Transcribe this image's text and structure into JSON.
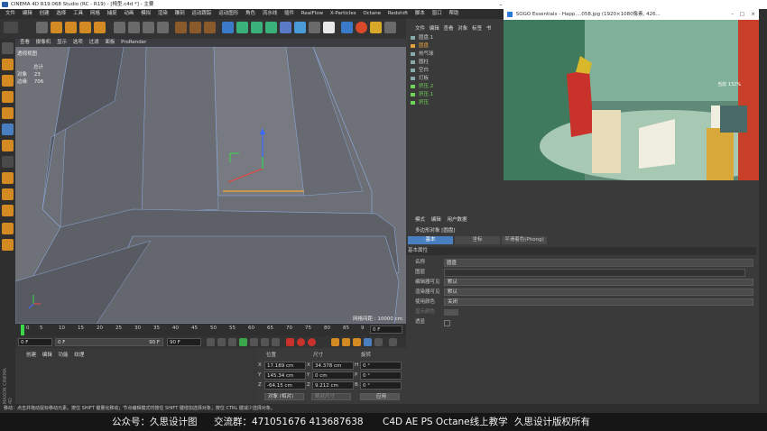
{
  "window": {
    "title": "CINEMA 4D R19.068 Studio (RC - R19) - [椅型.c4d *] - 主要"
  },
  "menu": [
    "文件",
    "编辑",
    "创建",
    "选择",
    "工具",
    "网格",
    "捕捉",
    "动画",
    "模拟",
    "渲染",
    "雕刻",
    "运动跟踪",
    "运动图形",
    "角色",
    "流水线",
    "插件",
    "RealFlow",
    "X-Particles",
    "Octane",
    "Redshift",
    "脚本",
    "窗口",
    "帮助"
  ],
  "viewport": {
    "menu": [
      "查看",
      "摄像机",
      "显示",
      "选项",
      "过滤",
      "面板",
      "ProRender"
    ],
    "camera_label": "透视视图",
    "stats": {
      "header": "总计",
      "rows": [
        {
          "label": "对象",
          "value": "23"
        },
        {
          "label": "边缘",
          "value": "706"
        }
      ]
    },
    "grid_label": "网格间距 : 10000 cm"
  },
  "timeline": {
    "ticks": [
      "0",
      "5",
      "10",
      "15",
      "20",
      "25",
      "30",
      "35",
      "40",
      "45",
      "50",
      "55",
      "60",
      "65",
      "70",
      "75",
      "80",
      "85",
      "9"
    ],
    "end_field": "0 F"
  },
  "transport": {
    "current_frame": "0 F",
    "range_start": "0 F",
    "range_end": "90 F",
    "end_frame": "90 F"
  },
  "material_manager": {
    "menu": [
      "创建",
      "编辑",
      "功能",
      "纹理"
    ]
  },
  "coordinates": {
    "headers": {
      "position": "位置",
      "size": "尺寸",
      "rotation": "旋转"
    },
    "rows": [
      {
        "axis": "X",
        "pos": "17.189 cm",
        "size_axis": "X",
        "size": "34.378 cm",
        "rot_axis": "H",
        "rot": "0 °"
      },
      {
        "axis": "Y",
        "pos": "145.34 cm",
        "size_axis": "Y",
        "size": "0 cm",
        "rot_axis": "P",
        "rot": "0 °"
      },
      {
        "axis": "Z",
        "pos": "-64.15 cm",
        "size_axis": "Z",
        "size": "9.212 cm",
        "rot_axis": "B",
        "rot": "0 °"
      }
    ],
    "mode": "对象 (相对)",
    "size_mode": "绝对尺寸",
    "apply": "应用"
  },
  "object_manager": {
    "menu": [
      "文件",
      "编辑",
      "查看",
      "对象",
      "标签",
      "书"
    ],
    "objects": [
      {
        "name": "圆盘.1",
        "color": "#c8c8c8"
      },
      {
        "name": "圆盘",
        "color": "#e6a23a"
      },
      {
        "name": "热气球",
        "color": "#c8c8c8"
      },
      {
        "name": "圆柱",
        "color": "#c8c8c8"
      },
      {
        "name": "空白",
        "color": "#c8c8c8"
      },
      {
        "name": "灯板",
        "color": "#c8c8c8"
      },
      {
        "name": "挤压.2",
        "color": "#6fd35a"
      },
      {
        "name": "挤压.1",
        "color": "#6fd35a"
      },
      {
        "name": "挤压",
        "color": "#6fd35a"
      }
    ]
  },
  "sogo": {
    "title": "SOGO Essentials - Happ....058.jpg (1920×1080像素, 426...",
    "zoom_label": "当前 132%"
  },
  "attributes": {
    "menu": [
      "模式",
      "编辑",
      "用户数据"
    ],
    "object_title": "多边形对象 [圆盘]",
    "tabs": [
      "基本",
      "坐标",
      "平滑着色(Phong)"
    ],
    "section": "基本属性",
    "fields": [
      {
        "label": "名称",
        "value": "圆盘"
      },
      {
        "label": "图层",
        "value": ""
      },
      {
        "label": "编辑器可见",
        "value": "默认"
      },
      {
        "label": "渲染器可见",
        "value": "默认"
      },
      {
        "label": "使用颜色",
        "value": "关闭"
      },
      {
        "label": "显示颜色",
        "value": ""
      },
      {
        "label": "透显",
        "value": ""
      }
    ]
  },
  "status_bar": {
    "text": "移动：点击并拖动鼠标移动元素。按住 SHIFT 键量化移动；节点编辑模式时按住 SHIFT 键增加选择对象；按住 CTRL 键减少选择对象。"
  },
  "footer": {
    "items": [
      "公众号：久思设计图",
      "交流群：471051676  413687638",
      "C4D AE PS Octane线上教学",
      "久思设计版权所有"
    ]
  },
  "colors": {
    "accent_blue": "#4a7fbf",
    "selection_orange": "#e6a23a",
    "green_objects": "#6fd35a"
  }
}
